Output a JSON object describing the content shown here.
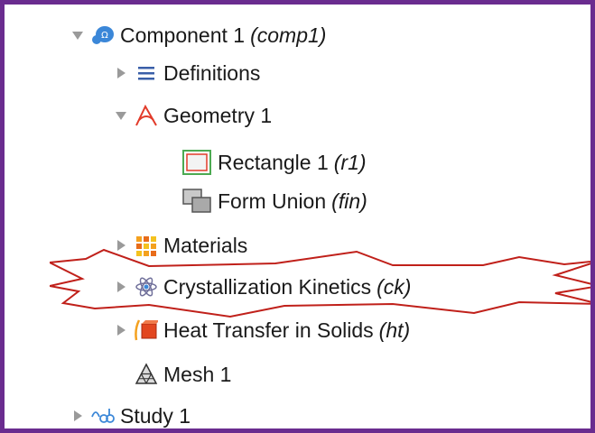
{
  "tree": {
    "component": {
      "label": "Component 1",
      "tag": "(comp1)",
      "expanded": true
    },
    "definitions": {
      "label": "Definitions",
      "expanded": false
    },
    "geometry": {
      "label": "Geometry 1",
      "expanded": true
    },
    "rectangle": {
      "label": "Rectangle 1",
      "tag": "(r1)"
    },
    "form_union": {
      "label": "Form Union",
      "tag": "(fin)"
    },
    "materials": {
      "label": "Materials",
      "expanded": false
    },
    "crystallization": {
      "label": "Crystallization Kinetics",
      "tag": "(ck)",
      "expanded": false,
      "highlighted": true
    },
    "heat_transfer": {
      "label": "Heat Transfer in Solids",
      "tag": "(ht)",
      "expanded": false
    },
    "mesh": {
      "label": "Mesh 1"
    },
    "study": {
      "label": "Study 1",
      "expanded": false
    }
  },
  "colors": {
    "frame_border": "#6a2c8f",
    "callout_stroke": "#c0201a",
    "caret": "#9a9a9a",
    "component_icon": "#3b87d8",
    "geometry_icon": "#e23b2a",
    "rectangle_icon_border": "#4caa52",
    "materials_icon": "#f4a11f",
    "heat_icon": "#e2461f"
  },
  "icons": {
    "component": "component-icon",
    "definitions": "definitions-list-icon",
    "geometry": "geometry-icon",
    "rectangle": "rectangle-icon",
    "form_union": "form-union-icon",
    "materials": "materials-icon",
    "crystallization": "crystallization-icon",
    "heat_transfer": "heat-transfer-icon",
    "mesh": "mesh-icon",
    "study": "study-icon"
  }
}
